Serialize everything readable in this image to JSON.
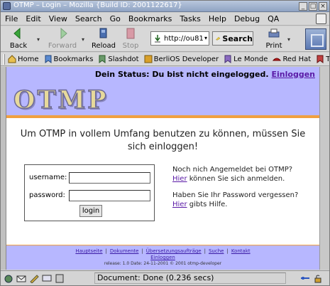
{
  "window": {
    "title": "OTMP – Login – Mozilla {Build ID: 2001122617}"
  },
  "menu": [
    "File",
    "Edit",
    "View",
    "Search",
    "Go",
    "Bookmarks",
    "Tasks",
    "Help",
    "Debug",
    "QA"
  ],
  "toolbar": {
    "back": "Back",
    "forward": "Forward",
    "reload": "Reload",
    "stop": "Stop",
    "url": "http://ou81",
    "search": "Search",
    "print": "Print"
  },
  "personal_toolbar": [
    "Home",
    "Bookmarks",
    "Slashdot",
    "BerliOS Developer",
    "Le Monde",
    "Red Hat",
    "TU"
  ],
  "page": {
    "status_text": "Dein Status: Du bist nicht eingelogged.",
    "login_link": "Einloggen",
    "logo_text": "OTMP",
    "headline": "Um OTMP in vollem Umfang benutzen zu können, müssen Sie sich einloggen!",
    "username_label": "username:",
    "username_value": "",
    "password_label": "password:",
    "password_value": "",
    "login_button": "login",
    "register_q": "Noch nich Angemeldet bei OTMP?",
    "register_link": "Hier",
    "register_rest": " können Sie sich anmelden.",
    "forgot_q": "Haben Sie Ihr Password vergessen?",
    "forgot_link": "Hier",
    "forgot_rest": " gibts Hilfe.",
    "footer_links": [
      "Hauptseite",
      "Dokumente",
      "Übersetzungsaufträge",
      "Suche",
      "Kontakt"
    ],
    "footer_link2": "Einloggen",
    "release": "release: 1.0 Date: 24-11-2001 © 2001 otmp-developer"
  },
  "status": {
    "text": "Document: Done (0.236 secs)"
  },
  "colors": {
    "accent": "#b7b7ff",
    "link": "#5a1aa6",
    "orange": "#f0a040"
  }
}
